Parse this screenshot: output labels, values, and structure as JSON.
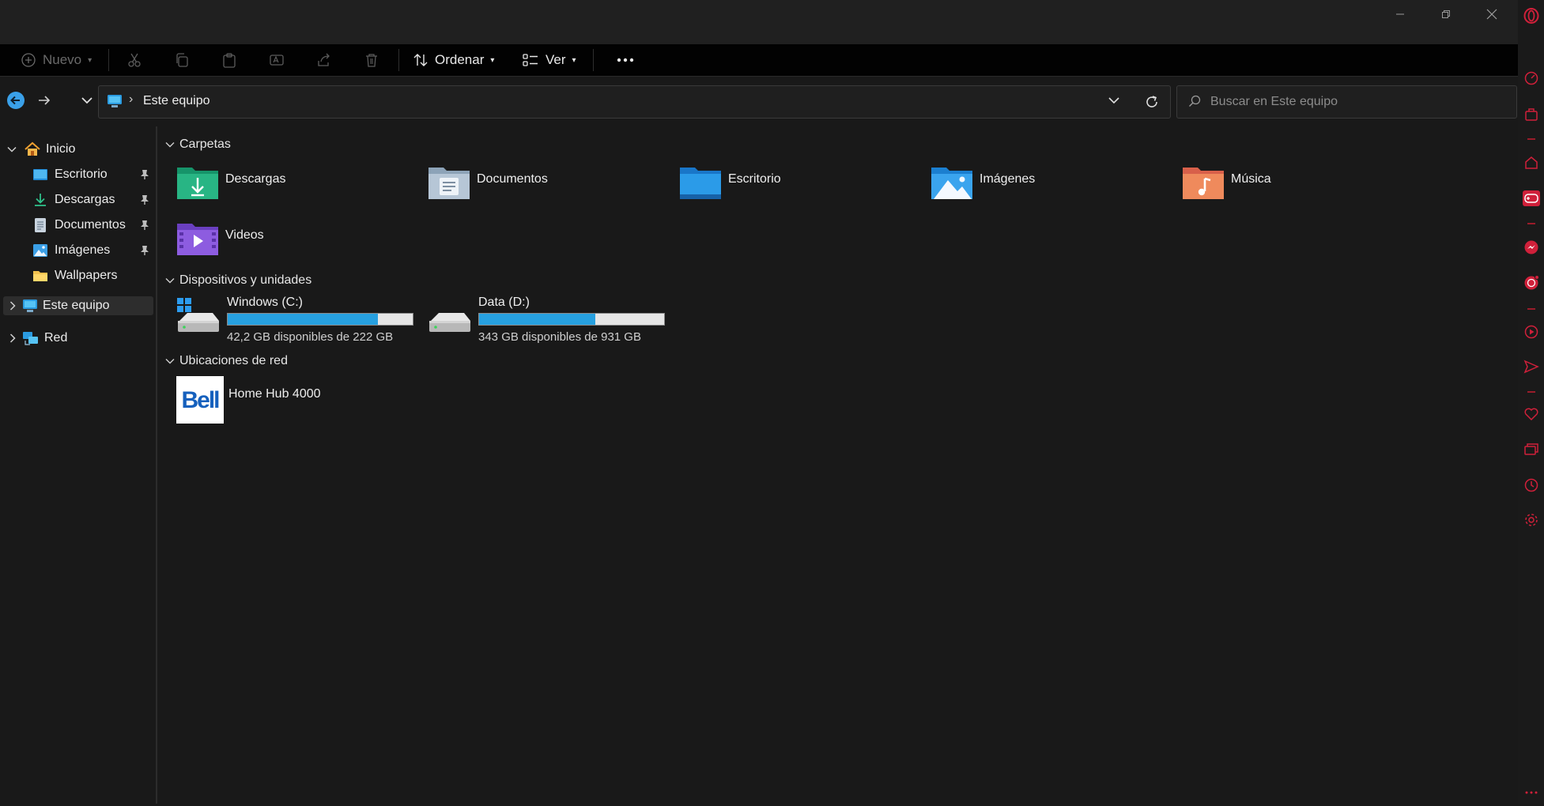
{
  "window": {
    "minimize_label": "Minimizar",
    "maximize_label": "Restaurar",
    "close_label": "Cerrar"
  },
  "toolbar": {
    "new_label": "Nuevo",
    "sort_label": "Ordenar",
    "view_label": "Ver",
    "more_label": "..."
  },
  "address": {
    "location": "Este equipo",
    "separator": "›"
  },
  "search": {
    "placeholder": "Buscar en Este equipo"
  },
  "sidebar": {
    "home": "Inicio",
    "pinned": [
      {
        "label": "Escritorio",
        "pinned": true,
        "icon": "desktop-icon"
      },
      {
        "label": "Descargas",
        "pinned": true,
        "icon": "download-icon"
      },
      {
        "label": "Documentos",
        "pinned": true,
        "icon": "document-icon"
      },
      {
        "label": "Imágenes",
        "pinned": true,
        "icon": "pictures-icon"
      },
      {
        "label": "Wallpapers",
        "pinned": false,
        "icon": "folder-icon"
      }
    ],
    "this_pc": "Este equipo",
    "network": "Red"
  },
  "sections": {
    "folders_title": "Carpetas",
    "devices_title": "Dispositivos y unidades",
    "network_title": "Ubicaciones de red"
  },
  "folders": [
    {
      "label": "Descargas",
      "icon": "downloads-folder-icon"
    },
    {
      "label": "Documentos",
      "icon": "documents-folder-icon"
    },
    {
      "label": "Escritorio",
      "icon": "desktop-folder-icon"
    },
    {
      "label": "Imágenes",
      "icon": "pictures-folder-icon"
    },
    {
      "label": "Música",
      "icon": "music-folder-icon"
    },
    {
      "label": "Videos",
      "icon": "videos-folder-icon"
    }
  ],
  "drives": [
    {
      "name": "Windows (C:)",
      "free_text": "42,2 GB disponibles de 222 GB",
      "used_fraction": 0.81
    },
    {
      "name": "Data (D:)",
      "free_text": "343 GB disponibles de 931 GB",
      "used_fraction": 0.63
    }
  ],
  "network_locations": [
    {
      "label": "Home Hub 4000",
      "logo_text": "Bell"
    }
  ],
  "colors": {
    "accent_blue": "#27a0e0",
    "opera_red": "#d0203a",
    "background": "#191919"
  }
}
